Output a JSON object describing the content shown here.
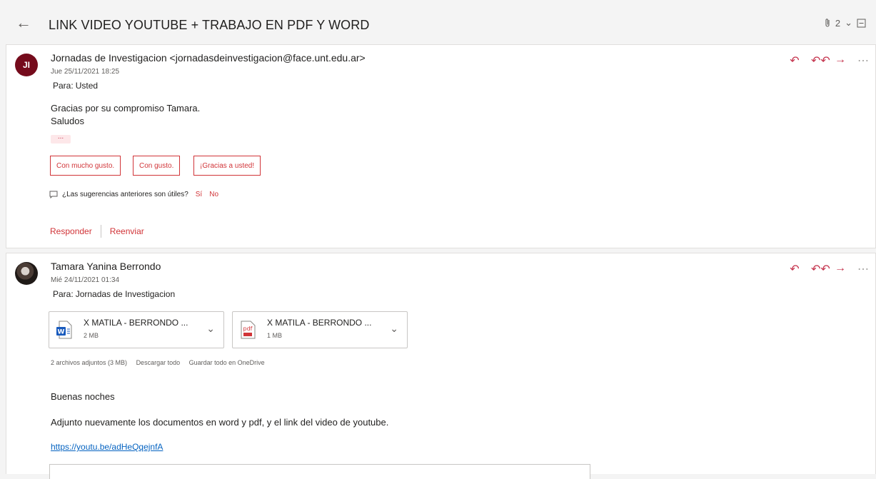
{
  "header": {
    "subject": "LINK VIDEO YOUTUBE + TRABAJO EN PDF Y WORD",
    "attachment_count": "2"
  },
  "messages": [
    {
      "initials": "JI",
      "from": "Jornadas de Investigacion <jornadasdeinvestigacion@face.unt.edu.ar>",
      "date": "Jue 25/11/2021 18:25",
      "to_label": "Para:",
      "to": "Usted",
      "body": [
        "Gracias por su compromiso Tamara.",
        "Saludos"
      ],
      "expand": "...",
      "suggestions": [
        "Con mucho gusto.",
        "Con gusto.",
        "¡Gracias a usted!"
      ],
      "feedback_question": "¿Las sugerencias anteriores son útiles?",
      "feedback_yes": "Sí",
      "feedback_no": "No",
      "reply": "Responder",
      "forward": "Reenviar"
    },
    {
      "from": "Tamara Yanina Berrondo",
      "date": "Mié 24/11/2021 01:34",
      "to_label": "Para:",
      "to": "Jornadas de Investigacion",
      "attachments": [
        {
          "name": "X MATILA - BERRONDO ...",
          "size": "2 MB",
          "type": "word-icon"
        },
        {
          "name": "X MATILA - BERRONDO ...",
          "size": "1 MB",
          "type": "pdf-icon"
        }
      ],
      "attachments_summary": "2 archivos adjuntos (3 MB)",
      "download_all": "Descargar todo",
      "save_onedrive": "Guardar todo en OneDrive",
      "greeting": "Buenas noches",
      "body": "Adjunto nuevamente los documentos en word y pdf, y el link del video de youtube.",
      "link": "https://youtu.be/adHeQqejnfA"
    }
  ],
  "colors": {
    "accent": "#c4314b",
    "avatar_ji": "#750b1c",
    "link": "#0563c1"
  }
}
